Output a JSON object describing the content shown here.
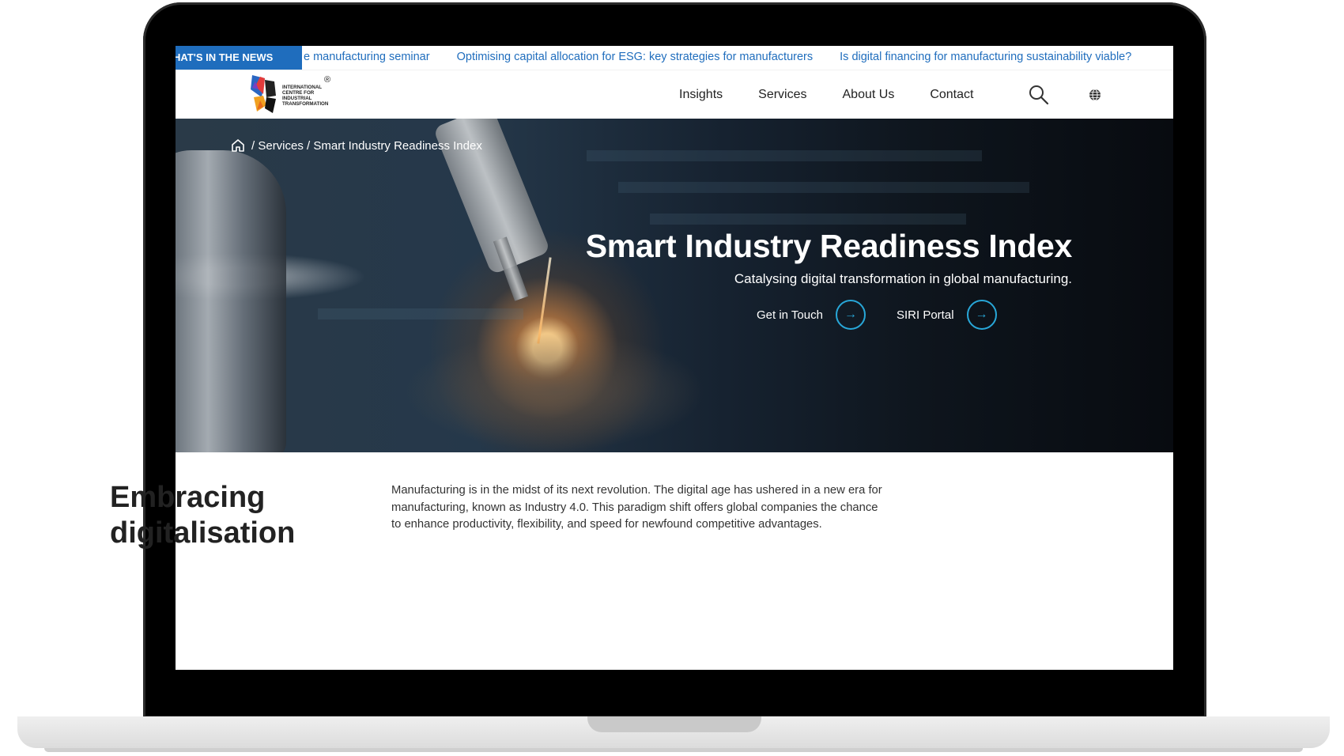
{
  "ticker": {
    "label": "HAT'S IN THE NEWS",
    "items": [
      "e manufacturing seminar",
      "Optimising capital allocation for ESG: key strategies for manufacturers",
      "Is digital financing for manufacturing sustainability viable?"
    ]
  },
  "header": {
    "logo_lines": [
      "INTERNATIONAL",
      "CENTRE FOR",
      "INDUSTRIAL",
      "TRANSFORMATION"
    ],
    "logo_reg": "®",
    "nav": [
      "Insights",
      "Services",
      "About Us",
      "Contact"
    ]
  },
  "hero": {
    "breadcrumb": {
      "sep1": "/",
      "services": "Services",
      "sep2": "/",
      "current": "Smart Industry Readiness Index"
    },
    "title": "Smart Industry Readiness Index",
    "subtitle": "Catalysing digital transformation in global manufacturing.",
    "cta_primary": "Get in Touch",
    "cta_secondary": "SIRI Portal",
    "arrow": "→"
  },
  "content": {
    "title_line1": "Embracing",
    "title_line2": "digitalisation",
    "body": "Manufacturing is in the midst of its next revolution. The digital age has ushered in a new era for manufacturing, known as Industry 4.0. This paradigm shift offers global companies the chance to enhance productivity, flexibility, and speed for newfound competitive advantages."
  },
  "colors": {
    "accent": "#1f6dbd",
    "cta_ring": "#28a7d8"
  }
}
